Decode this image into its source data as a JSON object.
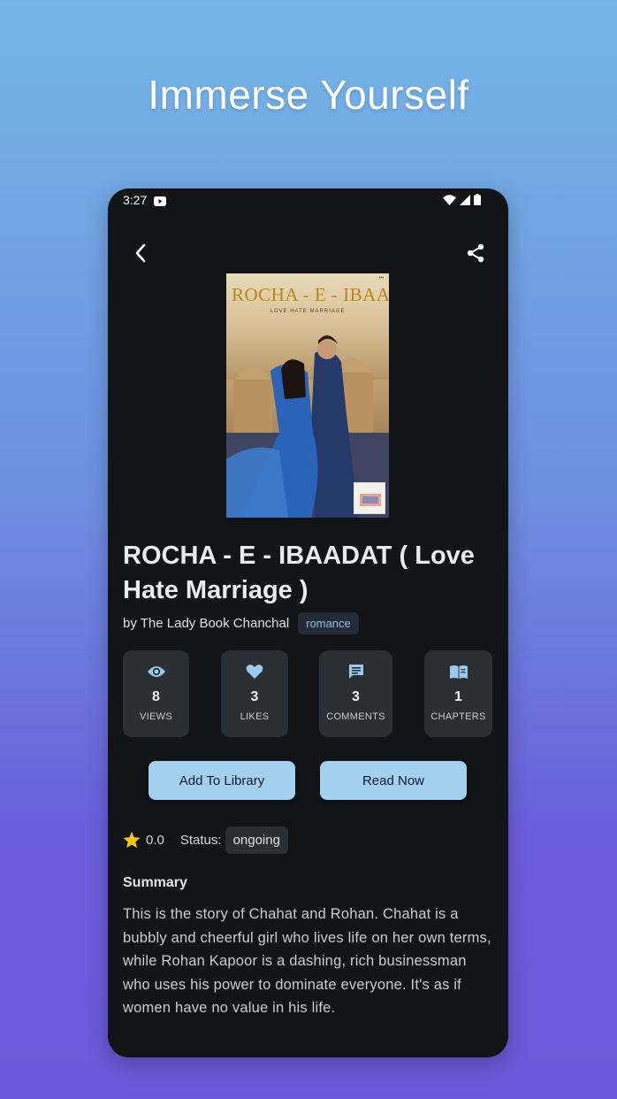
{
  "headline": "Immerse Yourself",
  "status_bar": {
    "time": "3:27"
  },
  "book": {
    "cover_title": "ROCHA - E - IBAADAT",
    "cover_subtitle": "LOVE HATE MARRIAGE",
    "title": "ROCHA - E - IBAADAT ( Love Hate Marriage )",
    "author": "by The Lady Book Chanchal",
    "genre": "romance"
  },
  "stats": [
    {
      "icon": "eye-icon",
      "value": "8",
      "label": "VIEWS"
    },
    {
      "icon": "heart-icon",
      "value": "3",
      "label": "LIKES"
    },
    {
      "icon": "comment-icon",
      "value": "3",
      "label": "COMMENTS"
    },
    {
      "icon": "book-icon",
      "value": "1",
      "label": "CHAPTERS"
    }
  ],
  "actions": {
    "add_library": "Add To Library",
    "read_now": "Read Now"
  },
  "rating": {
    "value": "0.0",
    "status_label": "Status:",
    "status": "ongoing"
  },
  "summary": {
    "heading": "Summary",
    "text": "This is the story of Chahat and Rohan. Chahat is a bubbly and cheerful girl who lives life on her own terms, while Rohan Kapoor is a dashing, rich businessman who uses his power to dominate everyone. It's as if women have no value in his life."
  },
  "colors": {
    "accent": "#a4d0f0",
    "chip_text": "#8fbfe6",
    "star": "#f5c518",
    "icon_blue": "#9ccaee"
  }
}
